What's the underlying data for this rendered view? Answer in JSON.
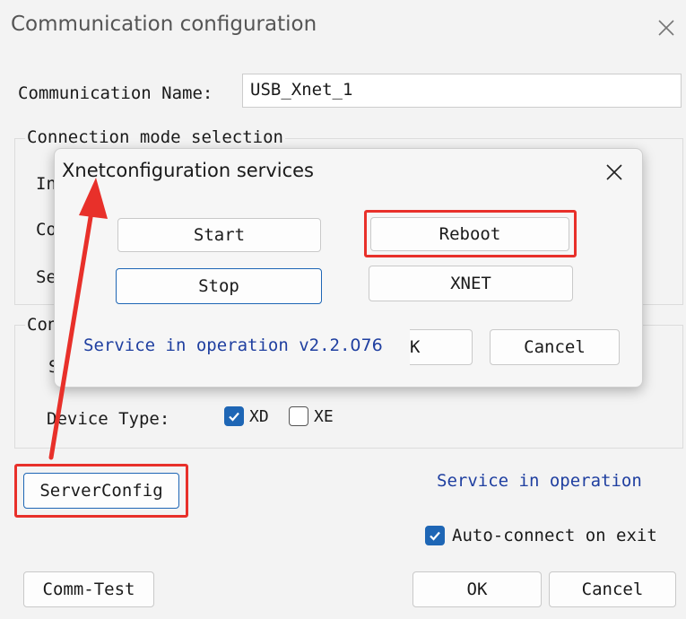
{
  "window": {
    "title": "Communication configuration"
  },
  "comm_name": {
    "label": "Communication Name:",
    "value": "USB_Xnet_1"
  },
  "connection_group": {
    "legend": "Connection mode selection",
    "row1_label": "In",
    "row2_label": "Co",
    "row3_label": "Se"
  },
  "second_group": {
    "legend": "Con",
    "row_label": "S"
  },
  "device_type": {
    "label": "Device Type:",
    "options": [
      {
        "label": "XD",
        "checked": true
      },
      {
        "label": "XE",
        "checked": false
      }
    ]
  },
  "server_config_label": "ServerConfig",
  "status_text": "Service in operation",
  "auto_connect": {
    "label": "Auto-connect on exit",
    "checked": true
  },
  "footer": {
    "comm_test": "Comm-Test",
    "ok": "OK",
    "cancel": "Cancel"
  },
  "popup": {
    "title": "Xnetconfiguration services",
    "start": "Start",
    "reboot": "Reboot",
    "stop": "Stop",
    "xnet": "XNET",
    "status_prefix": "Service in operation v2.2.",
    "version_suffix": "076",
    "ok_fragment": "K",
    "cancel": "Cancel"
  },
  "colors": {
    "accent": "#1e66b5",
    "status_text": "#1f3fa0",
    "highlight": "#e8302a",
    "arrow": "#e8302a"
  }
}
